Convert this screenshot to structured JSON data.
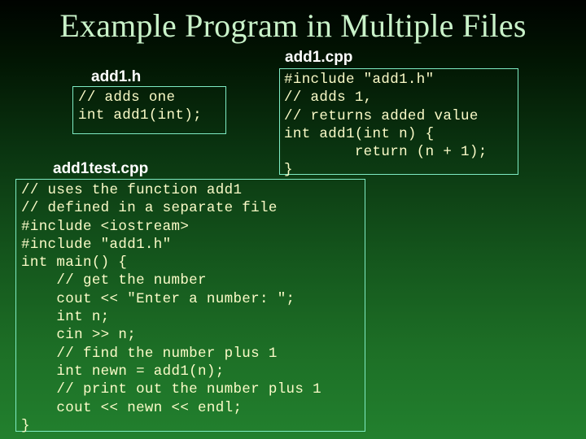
{
  "slide": {
    "title": "Example Program in Multiple Files",
    "colors": {
      "title_text": "#c9f2c9",
      "label_text": "#ffffff",
      "code_text": "#fbfbc8",
      "box_border": "#7fecc4",
      "background_top": "#000300",
      "background_bottom": "#22802e"
    }
  },
  "files": {
    "header": {
      "label": "add1.h",
      "code": "// adds one\nint add1(int);"
    },
    "implementation": {
      "label": "add1.cpp",
      "code": "#include \"add1.h\"\n// adds 1,\n// returns added value\nint add1(int n) {\n        return (n + 1);\n}"
    },
    "test": {
      "label": "add1test.cpp",
      "code": "// uses the function add1\n// defined in a separate file\n#include <iostream>\n#include \"add1.h\"\nint main() {\n    // get the number\n    cout << \"Enter a number: \";\n    int n;\n    cin >> n;\n    // find the number plus 1\n    int newn = add1(n);\n    // print out the number plus 1\n    cout << newn << endl;\n}"
    }
  }
}
